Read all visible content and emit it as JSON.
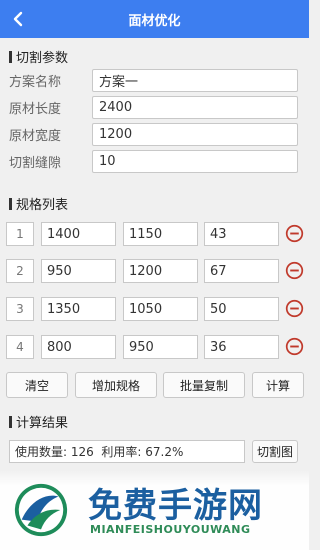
{
  "appbar": {
    "title": "面材优化",
    "back_icon": "chevron-left-icon"
  },
  "cut_params": {
    "heading": "切割参数",
    "fields": [
      {
        "label": "方案名称",
        "value": "方案一"
      },
      {
        "label": "原材长度",
        "value": "2400"
      },
      {
        "label": "原材宽度",
        "value": "1200"
      },
      {
        "label": "切割缝隙",
        "value": "10"
      }
    ]
  },
  "spec_list": {
    "heading": "规格列表",
    "rows": [
      {
        "index": "1",
        "length": "1400",
        "width": "1150",
        "qty": "43"
      },
      {
        "index": "2",
        "length": "950",
        "width": "1200",
        "qty": "67"
      },
      {
        "index": "3",
        "length": "1350",
        "width": "1050",
        "qty": "50"
      },
      {
        "index": "4",
        "length": "800",
        "width": "950",
        "qty": "36"
      }
    ],
    "delete_icon": "remove-circle-icon",
    "delete_color": "#c0392b"
  },
  "actions": {
    "clear": "清空",
    "add_spec": "增加规格",
    "batch_copy": "批量复制",
    "calculate": "计算"
  },
  "result": {
    "heading": "计算结果",
    "summary": "使用数量: 126  利用率: 67.2%",
    "cut_diagram": "切割图"
  },
  "watermark": {
    "cn": "免费手游网",
    "en": "MIANFEISHOUYOUWANG"
  },
  "colors": {
    "accent": "#3d7ef0"
  }
}
